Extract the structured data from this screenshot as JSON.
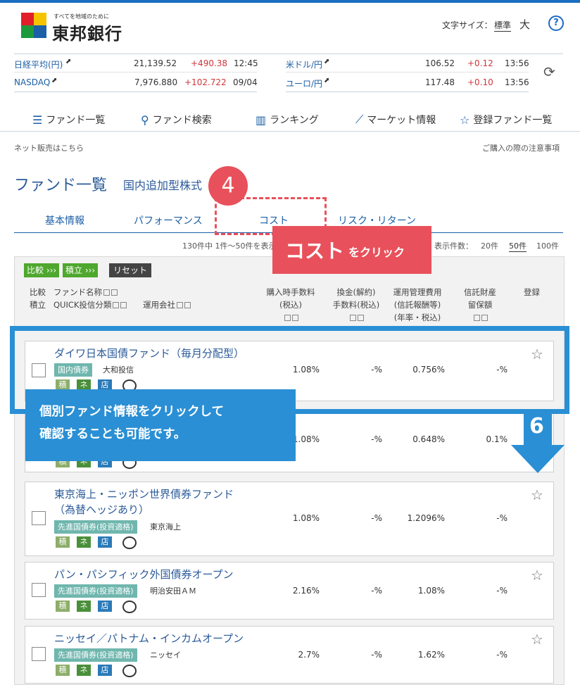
{
  "header": {
    "logo_text": "東邦銀行",
    "logo_tagline": "すべてを地域のために",
    "font_size_label": "文字サイズ：",
    "font_size_normal": "標準",
    "font_size_large": "大",
    "help_icon": "help-icon"
  },
  "markets": {
    "rows": [
      {
        "name": "日経平均(円)",
        "value": "21,139.52",
        "change": "+490.38",
        "time": "12:45"
      },
      {
        "name": "NASDAQ",
        "value": "7,976.880",
        "change": "+102.722",
        "time": "09/04"
      },
      {
        "name": "米ドル/円",
        "value": "106.52",
        "change": "+0.12",
        "time": "13:56"
      },
      {
        "name": "ユーロ/円",
        "value": "117.48",
        "change": "+0.10",
        "time": "13:56"
      }
    ]
  },
  "nav": {
    "items": [
      {
        "label": "ファンド一覧",
        "icon": "list-icon"
      },
      {
        "label": "ファンド検索",
        "icon": "search-icon"
      },
      {
        "label": "ランキング",
        "icon": "ranking-icon"
      },
      {
        "label": "マーケット情報",
        "icon": "chart-icon"
      },
      {
        "label": "登録ファンド一覧",
        "icon": "star-icon"
      }
    ]
  },
  "links": {
    "net_sales": "ネット販売はこちら",
    "notes": "ご購入の際の注意事項"
  },
  "page": {
    "title": "ファンド一覧",
    "subtitle": "国内追加型株式"
  },
  "tabs": [
    "基本情報",
    "パフォーマンス",
    "コスト",
    "リスク・リターン"
  ],
  "results": {
    "count_text": "130件中 1件〜50件を表示",
    "per_page_label": "表示件数：",
    "options": [
      "20件",
      "50件",
      "100件"
    ]
  },
  "actions": {
    "compare": "比較 ›››",
    "tsumitate": "積立 ›››",
    "reset": "リセット"
  },
  "table_header": {
    "col1_a": "比較",
    "col1_b": "積立",
    "fund_name": "ファンド名称",
    "quick_cat": "QUICK投信分類",
    "company": "運用会社",
    "purchase_fee_a": "購入時手数料",
    "purchase_fee_b": "(税込)",
    "exchange_fee_a": "換金(解約)",
    "exchange_fee_b": "手数料(税込)",
    "mgmt_fee_a": "運用管理費用",
    "mgmt_fee_b": "(信託報酬等)",
    "mgmt_fee_c": "(年率・税込)",
    "trust_a": "信託財産",
    "trust_b": "留保額",
    "register": "登録"
  },
  "badges": {
    "tsumi": "積",
    "net": "ネ",
    "store": "店"
  },
  "funds": [
    {
      "name1": "ダイワ日本国債ファンド（毎月分配型）",
      "name2": "",
      "category": "国内債券",
      "company": "大和投信",
      "purchase": "1.08%",
      "exchange": "-%",
      "mgmt": "0.756%",
      "trust": "-%"
    },
    {
      "name1": "",
      "name2": "",
      "category": "",
      "company": "",
      "purchase": "1.08%",
      "exchange": "-%",
      "mgmt": "0.648%",
      "trust": "0.1%"
    },
    {
      "name1": "東京海上・ニッポン世界債券ファンド",
      "name2": "（為替ヘッジあり）",
      "category": "先進国債券(投資適格)",
      "company": "東京海上",
      "purchase": "1.08%",
      "exchange": "-%",
      "mgmt": "1.2096%",
      "trust": "-%"
    },
    {
      "name1": "パン・パシフィック外国債券オープン",
      "name2": "",
      "category": "先進国債券(投資適格)",
      "company": "明治安田ＡＭ",
      "purchase": "2.16%",
      "exchange": "-%",
      "mgmt": "1.08%",
      "trust": "-%"
    },
    {
      "name1": "ニッセイ／パトナム・インカムオープン",
      "name2": "",
      "category": "先進国債券(投資適格)",
      "company": "ニッセイ",
      "purchase": "2.7%",
      "exchange": "-%",
      "mgmt": "1.62%",
      "trust": "-%"
    }
  ],
  "annotations": {
    "step4": "4",
    "cost_big": "コスト",
    "cost_small": "をクリック",
    "msg_line1": "個別ファンド情報をクリックして",
    "msg_line2": "確認することも可能です。",
    "step6": "6"
  },
  "colors": {
    "accent": "#1a6fc0",
    "annotation_red": "#e8515b",
    "annotation_blue": "#2a8fd4",
    "up_red": "#d0343b"
  }
}
